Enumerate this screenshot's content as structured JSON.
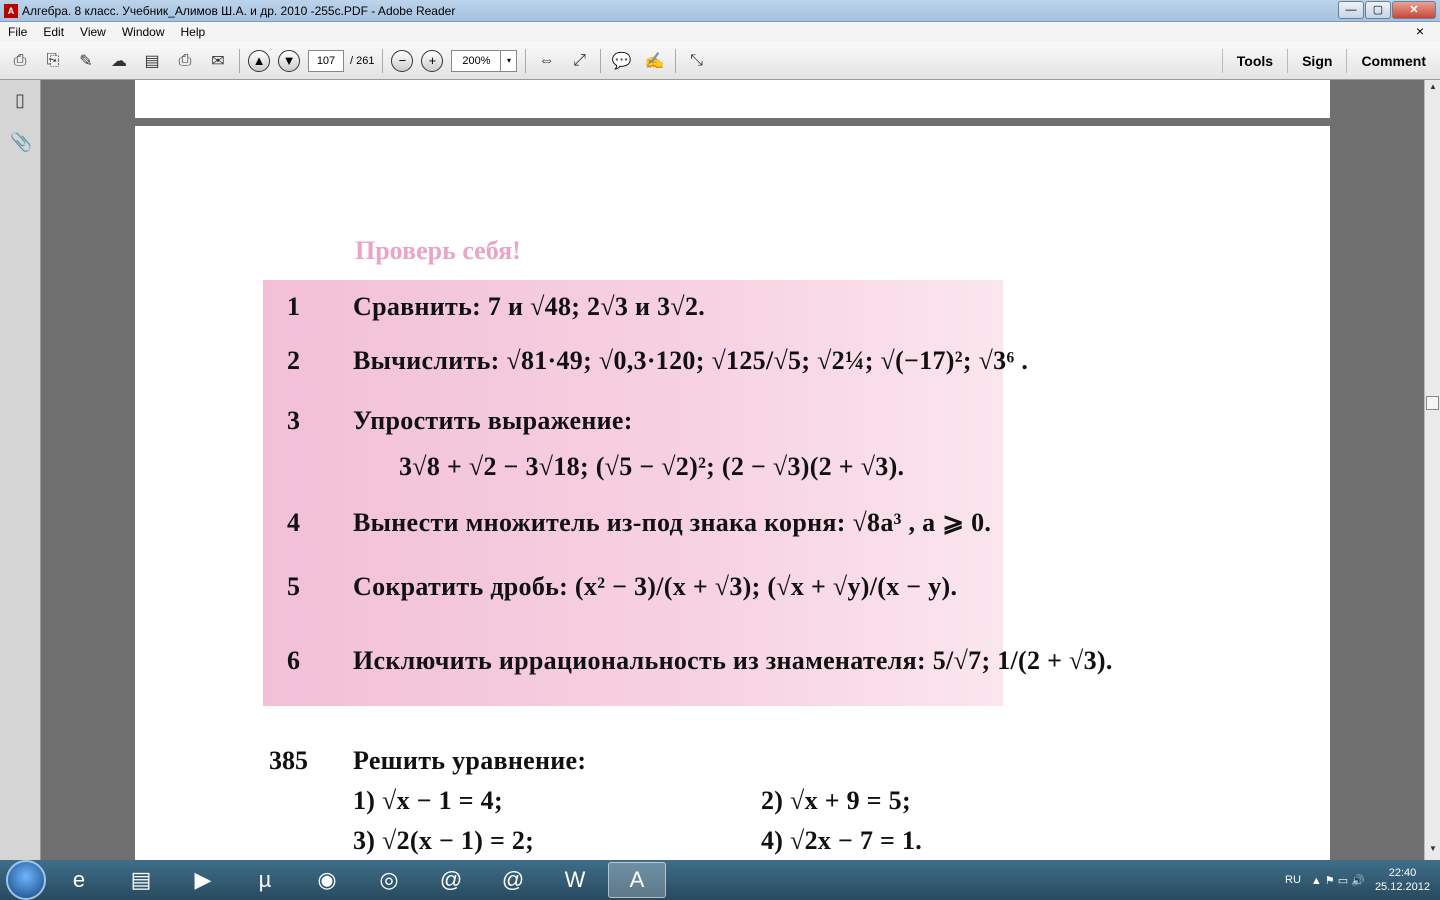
{
  "window": {
    "title": "Алгебра. 8 класс. Учебник_Алимов Ш.А. и др. 2010 -255с.PDF - Adobe Reader",
    "app_icon": "pdf-icon",
    "buttons": {
      "minimize": "—",
      "maximize": "▢",
      "close": "✕"
    }
  },
  "menu": {
    "items": [
      "File",
      "Edit",
      "View",
      "Window",
      "Help"
    ],
    "close_glyph": "×"
  },
  "toolbar": {
    "current_page": "107",
    "page_total": "/ 261",
    "zoom": "200%",
    "zoom_arrow": "▾",
    "glyphs": {
      "up": "▲",
      "down": "▼",
      "minus": "−",
      "plus": "+"
    },
    "right_links": [
      "Tools",
      "Sign",
      "Comment"
    ]
  },
  "document": {
    "heading": "Проверь себя!",
    "tasks": [
      {
        "num": "1",
        "text": "Сравнить:  7 и √48;   2√3 и 3√2."
      },
      {
        "num": "2",
        "text": "Вычислить: √81·49;  √0,3·120;  √125/√5;  √2¼;  √(−17)²;  √3⁶ ."
      },
      {
        "num": "3",
        "text": "Упростить выражение:",
        "sub": "3√8 + √2 − 3√18;   (√5 − √2)²;   (2 − √3)(2 + √3)."
      },
      {
        "num": "4",
        "text": "Вынести множитель из-под знака корня: √8a³ ,  a ⩾ 0."
      },
      {
        "num": "5",
        "text": "Сократить дробь:  (x² − 3)/(x + √3);   (√x + √y)/(x − y)."
      },
      {
        "num": "6",
        "text": "Исключить иррациональность из знаменателя:  5/√7;   1/(2 + √3)."
      }
    ],
    "exercise": {
      "num": "385",
      "title": "Решить уравнение:",
      "items": [
        "1)  √x − 1 = 4;",
        "2)  √x + 9 = 5;",
        "3)  √2(x − 1) = 2;",
        "4)  √2x − 7 = 1."
      ]
    }
  },
  "taskbar": {
    "apps": [
      "ie-icon",
      "explorer-icon",
      "media-icon",
      "utorrent-icon",
      "game-icon",
      "chrome-icon",
      "mail-agent-icon",
      "mail-agent-icon",
      "word-icon",
      "acrobat-icon"
    ],
    "app_glyphs": [
      "e",
      "▤",
      "▶",
      "µ",
      "◉",
      "◎",
      "@",
      "@",
      "W",
      "A"
    ],
    "lang": "RU",
    "tray_icons": "▲  ⚑  ▭  🔊",
    "time": "22:40",
    "date": "25.12.2012"
  }
}
